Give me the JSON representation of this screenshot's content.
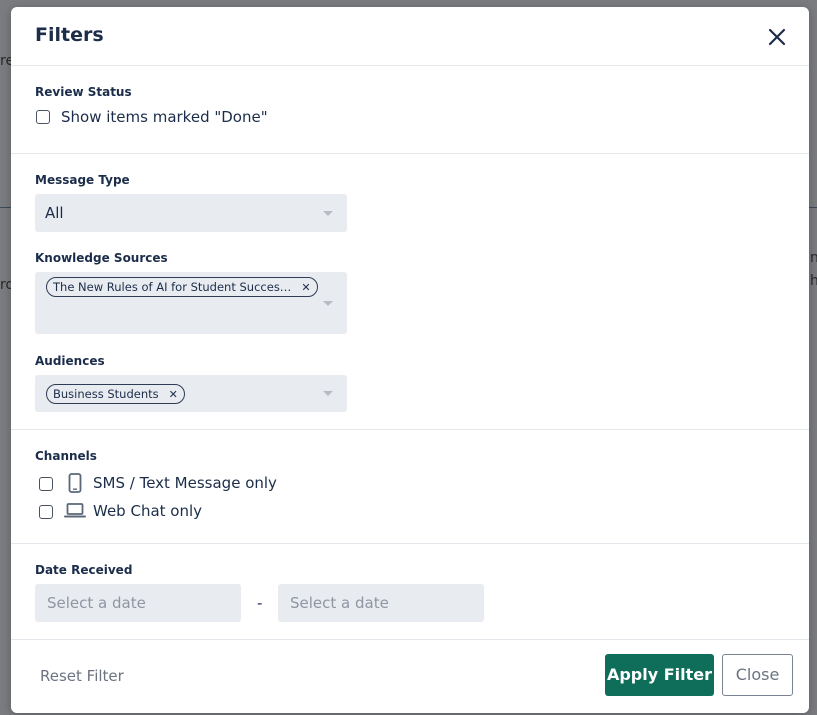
{
  "modal": {
    "title": "Filters",
    "close_icon": "close-icon"
  },
  "review_status": {
    "label": "Review Status",
    "show_done_label": "Show items marked \"Done\"",
    "show_done_checked": false
  },
  "message_type": {
    "label": "Message Type",
    "value": "All"
  },
  "knowledge_sources": {
    "label": "Knowledge Sources",
    "chips": [
      "The New Rules of AI for Student Succes…"
    ]
  },
  "audiences": {
    "label": "Audiences",
    "chips": [
      "Business Students"
    ]
  },
  "channels": {
    "label": "Channels",
    "sms_label": "SMS / Text Message only",
    "sms_icon": "mobile-phone-icon",
    "sms_checked": false,
    "web_label": "Web Chat only",
    "web_icon": "laptop-icon",
    "web_checked": false
  },
  "date_received": {
    "label": "Date Received",
    "from_placeholder": "Select a date",
    "separator": "-",
    "to_placeholder": "Select a date"
  },
  "footer": {
    "reset_label": "Reset Filter",
    "apply_label": "Apply Filter",
    "close_label": "Close"
  },
  "colors": {
    "primary": "#0e6e5a",
    "field_bg": "#e8ebef",
    "title": "#1c2d4a"
  }
}
